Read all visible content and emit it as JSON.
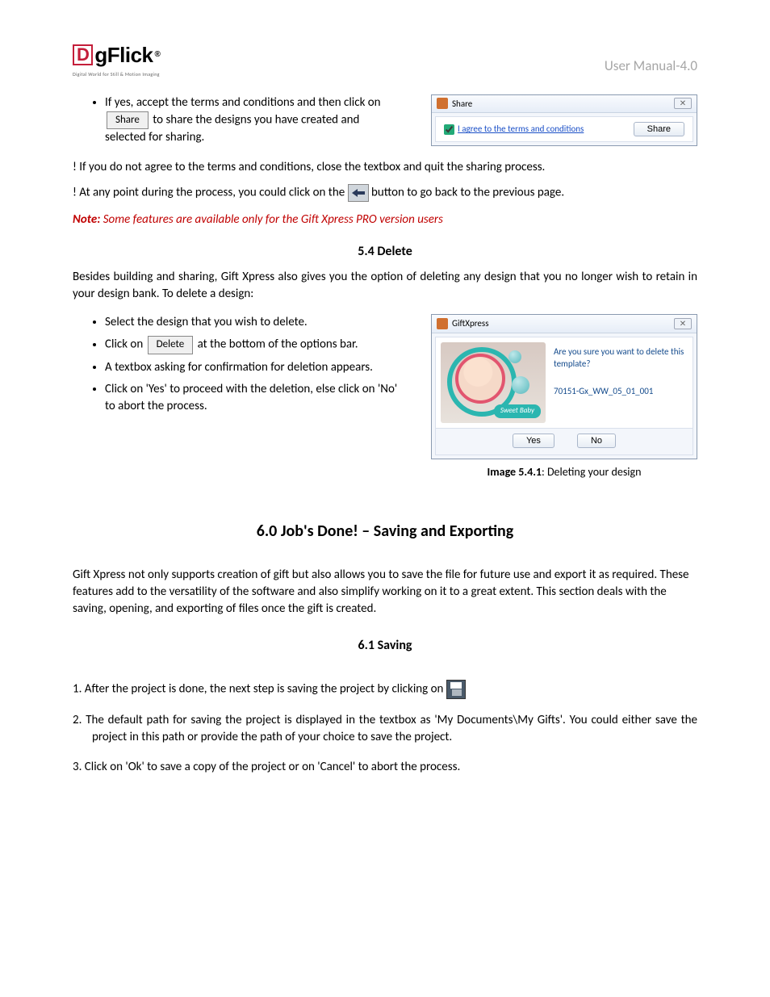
{
  "header": {
    "logo_d": "D",
    "logo_rest": "gFlick",
    "logo_reg": "®",
    "logo_tagline": "Digital World for Still & Motion Imaging",
    "manual_version": "User Manual-4.0"
  },
  "share_section": {
    "bullet_pre": "If yes, accept the terms and conditions and then click on ",
    "share_btn": "Share",
    "bullet_post": " to share the designs you have created and selected for sharing.",
    "bang1_pre": "! If you do not agree to the terms and conditions, close the textbox and quit the sharing process.",
    "bang2_pre": "! At any point during the process, you could click on the ",
    "bang2_post": "button to go back to the previous page.",
    "note_label": "Note:",
    "note_text": " Some features are available only for the Gift Xpress PRO version users"
  },
  "share_dialog": {
    "title": "Share",
    "terms_link": "I agree to the terms and conditions",
    "share_btn": "Share",
    "close_glyph": "✕"
  },
  "delete_section": {
    "heading": "5.4 Delete",
    "intro": "Besides building and sharing, Gift Xpress also gives you the option of deleting any design that you no longer wish to retain in your design bank. To delete a design:",
    "b1": "Select the design that you wish to delete.",
    "b2_pre": "Click on ",
    "delete_btn": "Delete",
    "b2_post": " at the bottom of the options bar.",
    "b3": "A textbox asking for confirmation for deletion appears.",
    "b4": "Click on 'Yes' to proceed with the deletion, else click on 'No' to abort the process."
  },
  "gx_dialog": {
    "title": "GiftXpress",
    "question": "Are you sure you want to delete this template?",
    "template_id": "70151-Gx_WW_05_01_001",
    "yes": "Yes",
    "no": "No",
    "thumb_label": "Sweet Baby",
    "close_glyph": "✕"
  },
  "gx_caption_bold": "Image 5.4.1",
  "gx_caption_rest": ": Deleting your design",
  "job_done": {
    "heading": "6.0 Job's Done! – Saving and Exporting",
    "intro": "Gift Xpress not only supports creation of gift but also allows you to save the file for future use and export it as required. These features add to the versatility of the software and also simplify working on it to a great extent. This section deals with the saving, opening, and exporting of files once the gift is created."
  },
  "saving": {
    "heading": "6.1 Saving",
    "s1_pre": "1. After the project is done, the next step is saving the project by clicking on ",
    "s2": "2. The default path for saving the project is displayed in the textbox as 'My Documents\\My Gifts'. You could either save the project in this path or provide the path of your choice to save the project.",
    "s3": "3. Click on 'Ok' to save a copy of the project or on 'Cancel' to abort the process."
  }
}
